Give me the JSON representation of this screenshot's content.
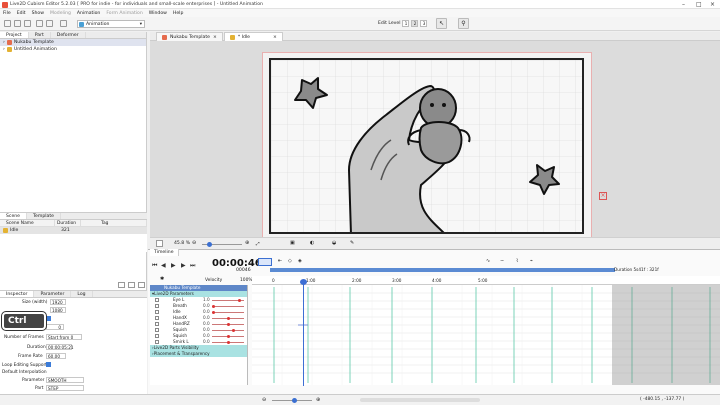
{
  "window": {
    "title": "Live2D Cubism Editor 5.2.03   [ PRO for indie - for individuals and small-scale enterprises ]   - Untitled Animation"
  },
  "menu": [
    "File",
    "Edit",
    "Show",
    "Modeling",
    "Animation",
    "Form Animation",
    "Window",
    "Help"
  ],
  "toolbar": {
    "mode": "Animation",
    "edit_level_label": "Edit Level",
    "levels": [
      "1",
      "2",
      "3"
    ]
  },
  "left": {
    "tabs": [
      "Project",
      "Part",
      "Deformer"
    ],
    "tree": [
      "Nukabu Template",
      "Untitled Animation"
    ],
    "scene_tabs": [
      "Scene",
      "Template"
    ],
    "scene_cols": [
      "Scene Name",
      "Duration",
      "Tag"
    ],
    "scene_rows": [
      {
        "name": "Idle",
        "duration": "321",
        "tag": ""
      }
    ],
    "inspector_tabs": [
      "Inspector",
      "Parameter",
      "Log"
    ],
    "fields": {
      "size_label": "Size (width)",
      "size_w": "1920",
      "size_h": "1080",
      "start_label": "Start Fr",
      "start_val": "0",
      "nof_label": "Number of Frames",
      "nof_val": "Start from 0",
      "dur_label": "Duration",
      "dur_val": "00:00:05:21",
      "fr_label": "Frame Rate",
      "fr_val": "60.00",
      "loop_label": "Loop Editing Support",
      "interp_label": "Default Interpolation",
      "param_label": "Parameter",
      "param_val": "SMOOTH",
      "part_label": "Part",
      "part_val": "STEP"
    },
    "ctrl_badge": "Ctrl"
  },
  "doc": {
    "tabs": [
      "Nukabu Template",
      "* Idle"
    ],
    "zoom": "45.8 %"
  },
  "timeline": {
    "tab": "Timeline",
    "time": "00:00:46",
    "frame": "00046",
    "velocity_label": "Velocity",
    "velocity_val": "100%",
    "duration_label": "Duration 5s41f : 321f",
    "tracks": {
      "root": "Nukabu Template",
      "group1": "Live2D Parameters",
      "params": [
        {
          "name": "Eye L",
          "value": "1.0"
        },
        {
          "name": "Breath",
          "value": "0.0"
        },
        {
          "name": "Idle",
          "value": "0.0"
        },
        {
          "name": "HandX",
          "value": "0.0"
        },
        {
          "name": "HandRZ",
          "value": "0.0"
        },
        {
          "name": "Squish",
          "value": "0.0"
        },
        {
          "name": "Squish",
          "value": "0.0"
        },
        {
          "name": "Smirk L",
          "value": "0.0"
        }
      ],
      "group2": "Live2D Parts Visibility",
      "group3": "Placement & Transparency"
    },
    "ruler_ticks": [
      "0",
      "1:00",
      "2:00",
      "3:00",
      "4:00",
      "5:00"
    ],
    "y_ticks": [
      "1.0",
      "0.8",
      "0.6",
      "0.4",
      "0.2",
      "0.0",
      "-0.2",
      "-0.4",
      "-0.6",
      "-0.8",
      "-1.0"
    ]
  },
  "status": {
    "coords": "( -480.15 , -137.77 )"
  }
}
